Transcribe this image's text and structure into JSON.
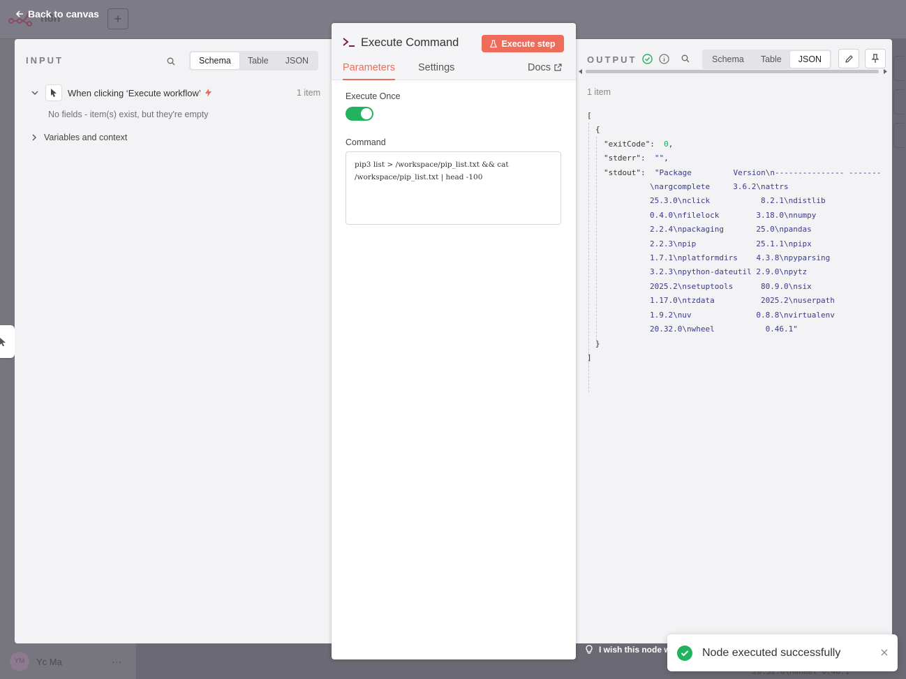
{
  "backdrop": {
    "logo_text": "n8n",
    "add_label": "+",
    "user_initials": "YM",
    "user_name": "Yc Ma",
    "more_label": "···",
    "feedback_text": "I wish this node w",
    "snippet_text": "20.32.0\\nwheel     0.46.1"
  },
  "nav": {
    "back_label": "Back to canvas"
  },
  "input": {
    "title": "INPUT",
    "view_tabs": [
      "Schema",
      "Table",
      "JSON"
    ],
    "active_tab": "Schema",
    "trigger_label": "When clicking ‘Execute workflow’",
    "item_count": "1 item",
    "empty_message": "No fields - item(s) exist, but they're empty",
    "variables_label": "Variables and context"
  },
  "node": {
    "title": "Execute Command",
    "execute_label": "Execute step",
    "tabs": {
      "parameters": "Parameters",
      "settings": "Settings",
      "docs": "Docs"
    },
    "execute_once_label": "Execute Once",
    "execute_once_value": true,
    "command_label": "Command",
    "command_value": "pip3 list > /workspace/pip_list.txt && cat /workspace/pip_list.txt | head -100"
  },
  "output": {
    "title": "OUTPUT",
    "view_tabs": [
      "Schema",
      "Table",
      "JSON"
    ],
    "active_tab": "JSON",
    "item_count": "1 item",
    "json": {
      "open_bracket": "[",
      "open_brace": "{",
      "exitCode_key": "\"exitCode\":",
      "exitCode_value": "0",
      "stderr_key": "\"stderr\":",
      "stderr_value": "\"\"",
      "stdout_key": "\"stdout\":",
      "stdout_lines": [
        "\"Package         Version\\n--------------- -------",
        "\\nargcomplete     3.6.2\\nattrs",
        "25.3.0\\nclick           8.2.1\\ndistlib",
        "0.4.0\\nfilelock        3.18.0\\nnumpy",
        "2.2.4\\npackaging       25.0\\npandas",
        "2.2.3\\npip             25.1.1\\npipx",
        "1.7.1\\nplatformdirs    4.3.8\\npyparsing",
        "3.2.3\\npython-dateutil 2.9.0\\npytz",
        "2025.2\\nsetuptools      80.9.0\\nsix",
        "1.17.0\\ntzdata          2025.2\\nuserpath",
        "1.9.2\\nuv              0.8.8\\nvirtualenv",
        "20.32.0\\nwheel           0.46.1\""
      ],
      "close_brace": "}",
      "close_bracket": "]"
    }
  },
  "toast": {
    "message": "Node executed successfully"
  },
  "colors": {
    "accent": "#ef6c5b",
    "success": "#22b35e"
  }
}
